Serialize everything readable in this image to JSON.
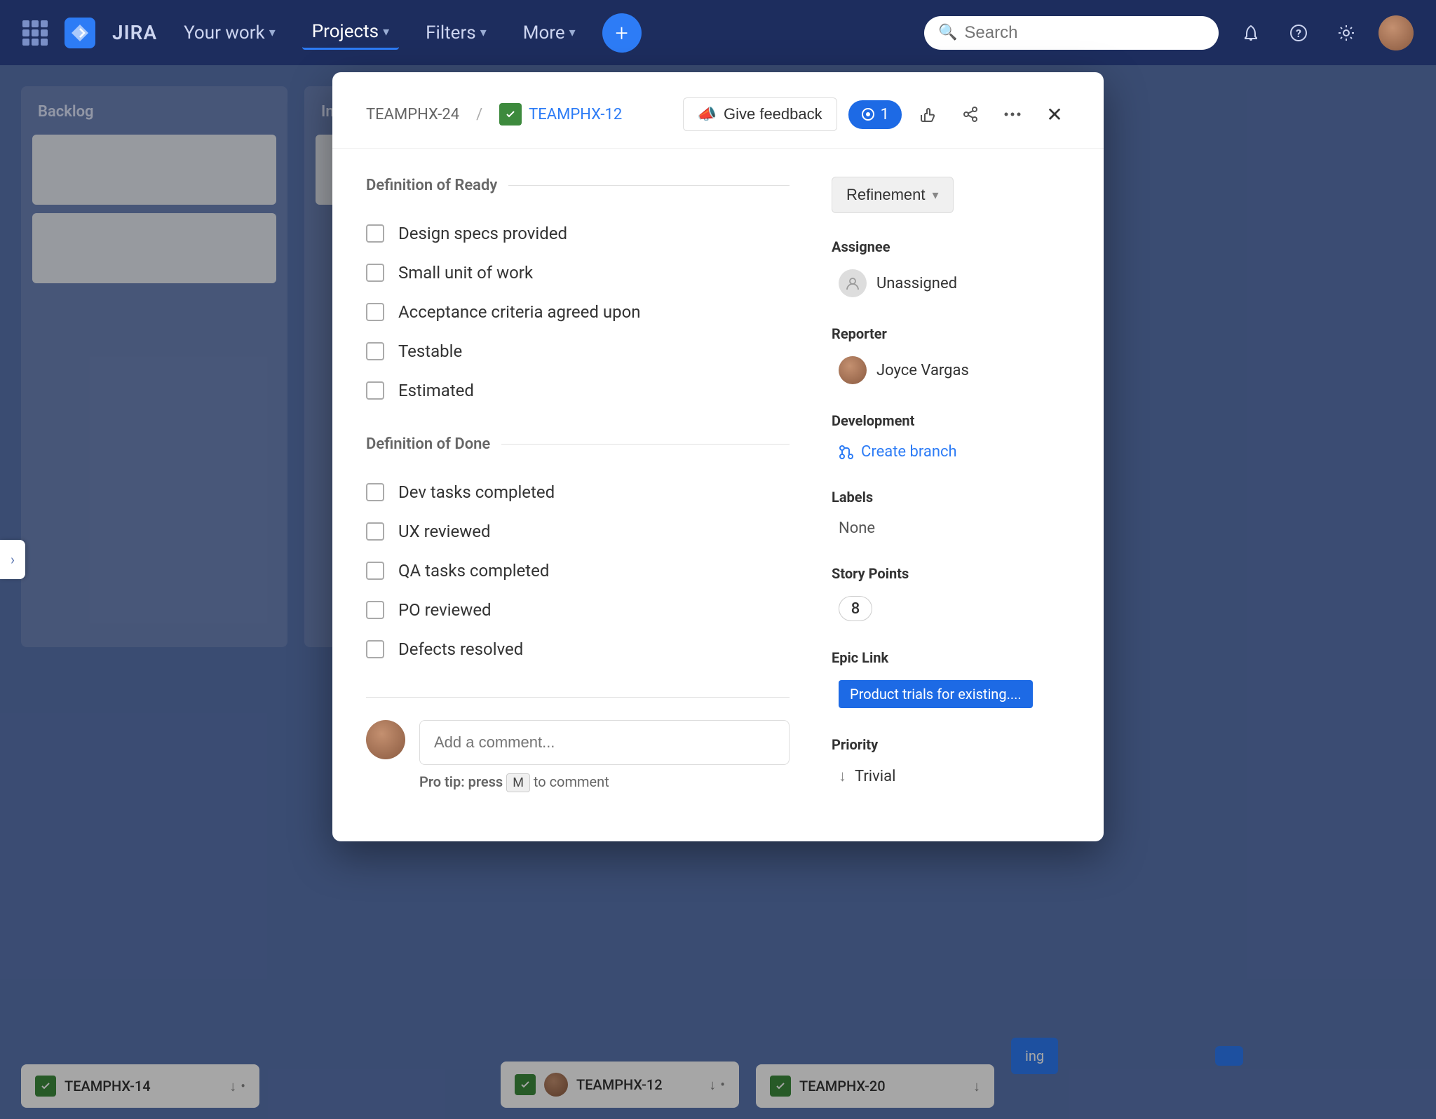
{
  "nav": {
    "brand": "JIRA",
    "items": [
      {
        "label": "Your work",
        "active": false
      },
      {
        "label": "Projects",
        "active": true
      },
      {
        "label": "Filters",
        "active": false
      },
      {
        "label": "More",
        "active": false
      }
    ],
    "search_placeholder": "Search",
    "create_label": "+"
  },
  "modal": {
    "breadcrumb_parent": "TEAMPHX-24",
    "breadcrumb_child": "TEAMPHX-12",
    "feedback_label": "Give feedback",
    "watch_count": "1",
    "sprint_label": "Refinement",
    "sections": {
      "ready_title": "Definition of Ready",
      "ready_items": [
        "Design specs provided",
        "Small unit of work",
        "Acceptance criteria agreed upon",
        "Testable",
        "Estimated"
      ],
      "done_title": "Definition of Done",
      "done_items": [
        "Dev tasks completed",
        "UX reviewed",
        "QA tasks completed",
        "PO reviewed",
        "Defects resolved"
      ]
    },
    "comment_placeholder": "Add a comment...",
    "comment_tip": "Pro tip: press",
    "comment_tip_key": "M",
    "comment_tip_suffix": "to comment",
    "fields": {
      "assignee_label": "Assignee",
      "assignee_value": "Unassigned",
      "reporter_label": "Reporter",
      "reporter_value": "Joyce Vargas",
      "development_label": "Development",
      "create_branch_label": "Create branch",
      "labels_label": "Labels",
      "labels_value": "None",
      "story_points_label": "Story Points",
      "story_points_value": "8",
      "epic_link_label": "Epic Link",
      "epic_link_value": "Product trials for existing....",
      "priority_label": "Priority",
      "priority_value": "Trivial"
    }
  },
  "board": {
    "bottom_cards": [
      {
        "id": "TEAMPHX-14",
        "text": "TEAMPHX-14"
      },
      {
        "id": "TEAMPHX-12",
        "text": "TEAMPHX-12"
      },
      {
        "id": "TEAMPHX-20",
        "text": "TEAMPHX-20"
      }
    ]
  }
}
